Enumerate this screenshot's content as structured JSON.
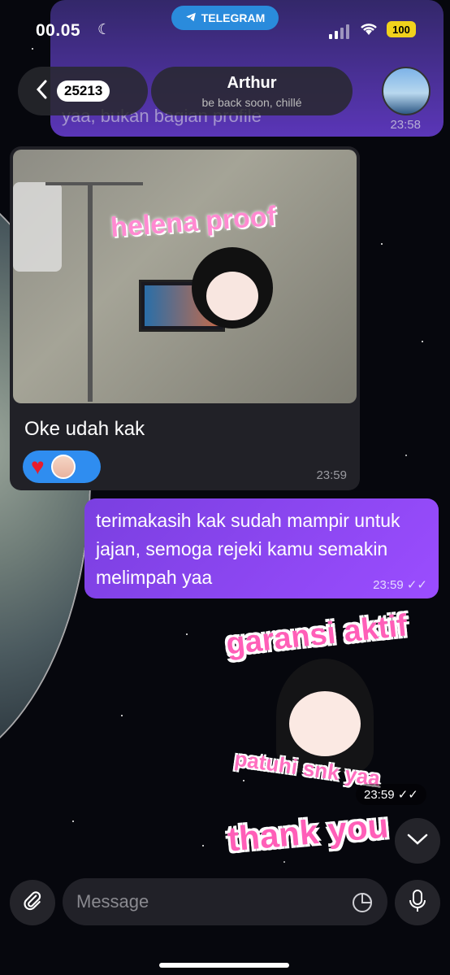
{
  "status_bar": {
    "time": "00.05",
    "app_pill": "TELEGRAM",
    "battery": "100"
  },
  "header": {
    "back_count": "25213",
    "name": "Arthur",
    "status": "be back soon, chillé"
  },
  "messages": {
    "previous": {
      "text": "yaa, bukan bagian profile",
      "time": "23:58"
    },
    "incoming": {
      "photo_sticker_text": "helena proof",
      "text": "Oke udah kak",
      "time": "23:59"
    },
    "outgoing": {
      "text": "terimakasih kak sudah mampir untuk jajan, semoga rejeki kamu semakin melimpah yaa",
      "time": "23:59"
    },
    "sticker": {
      "title": "garansi aktif",
      "subtitle": "patuhi snk yaa",
      "time": "23:59"
    },
    "sticker2": {
      "text": "thank you"
    }
  },
  "composer": {
    "placeholder": "Message"
  },
  "colors": {
    "accent": "#9b4dff",
    "reaction": "#2f8df0",
    "telegram": "#2a8bdc"
  }
}
